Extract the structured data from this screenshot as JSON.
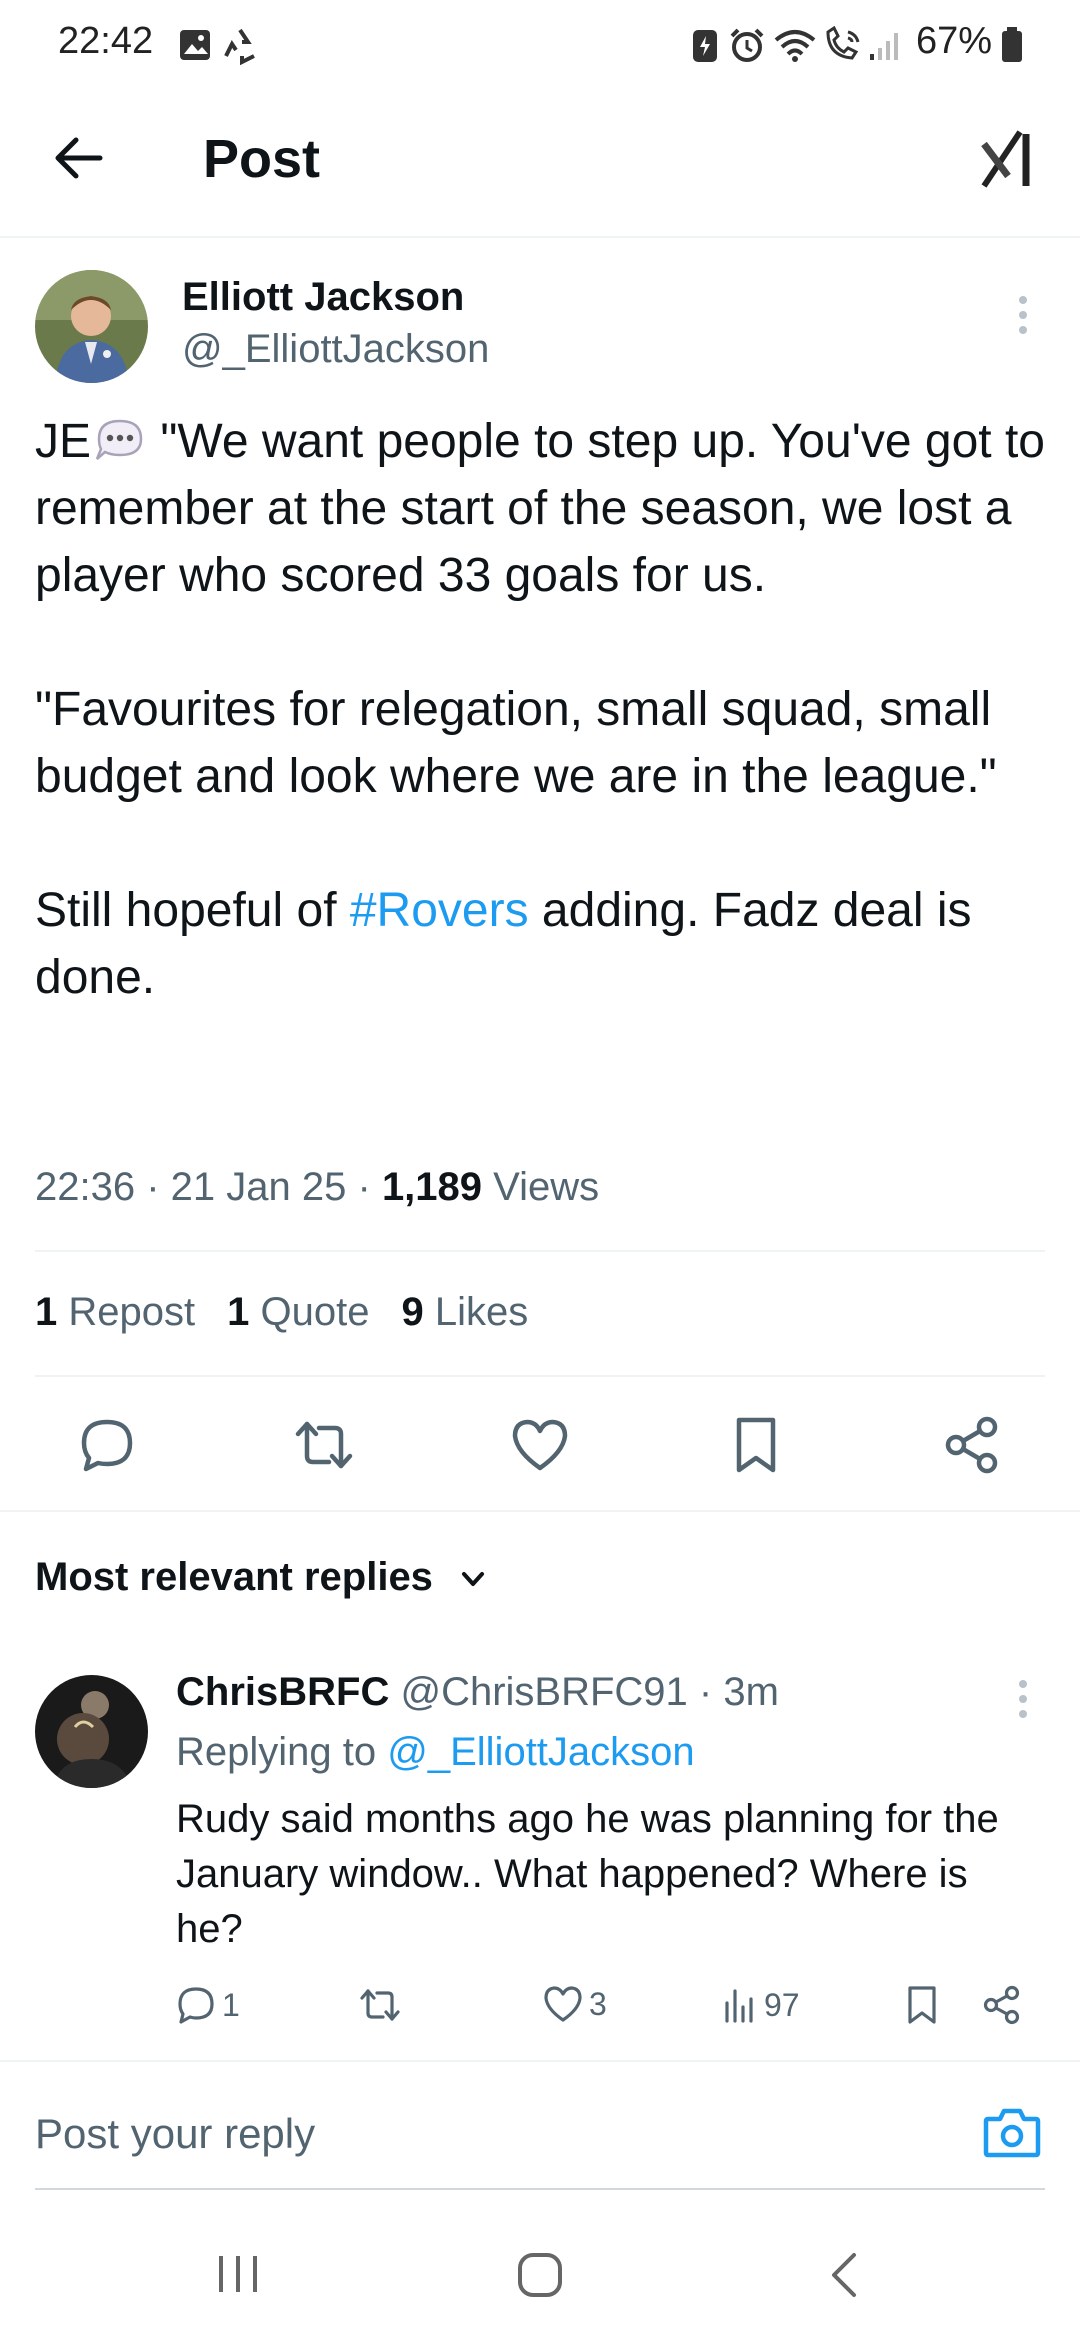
{
  "status_bar": {
    "time": "22:42",
    "battery": "67%",
    "icons": [
      "image-icon",
      "recycle-icon",
      "battery-saver-icon",
      "alarm-icon",
      "wifi-icon",
      "wifi-calling-icon",
      "signal-icon",
      "battery-icon"
    ]
  },
  "header": {
    "title": "Post",
    "back_icon": "back-arrow-icon",
    "app_icon": "x-grok-icon"
  },
  "post": {
    "author_name": "Elliott Jackson",
    "author_handle": "@_ElliottJackson",
    "text": {
      "line1_prefix": "JE",
      "line1_rest": " \"We want people to step up. You've got to remember at the start of the season, we lost a player who scored 33 goals for us.",
      "para2": "\"Favourites for relegation, small squad, small budget and look where we are in the league.\"",
      "para3_before": "Still hopeful of ",
      "hashtag": "#Rovers",
      "para3_after": " adding. Fadz deal is done."
    },
    "time": "22:36",
    "date": "21 Jan 25",
    "views_count": "1,189",
    "views_label": "Views",
    "stats": {
      "reposts_count": "1",
      "reposts_label": "Repost",
      "quotes_count": "1",
      "quotes_label": "Quote",
      "likes_count": "9",
      "likes_label": "Likes"
    },
    "actions": [
      "reply-icon",
      "repost-icon",
      "like-icon",
      "bookmark-icon",
      "share-icon"
    ]
  },
  "replies_section": {
    "title": "Most relevant replies"
  },
  "reply": {
    "name": "ChrisBRFC",
    "handle_time": "@ChrisBRFC91 · 3m",
    "replying_prefix": "Replying to",
    "replying_handle": "@_ElliottJackson",
    "text": "Rudy said months ago he was planning for the January window.. What happened? Where is he?",
    "reply_count": "1",
    "like_count": "3",
    "views_count": "97"
  },
  "composer": {
    "placeholder": "Post your reply"
  },
  "colors": {
    "accent": "#1d9bf0",
    "text": "#0f1419",
    "secondary": "#536471",
    "divider": "#eff3f4"
  }
}
